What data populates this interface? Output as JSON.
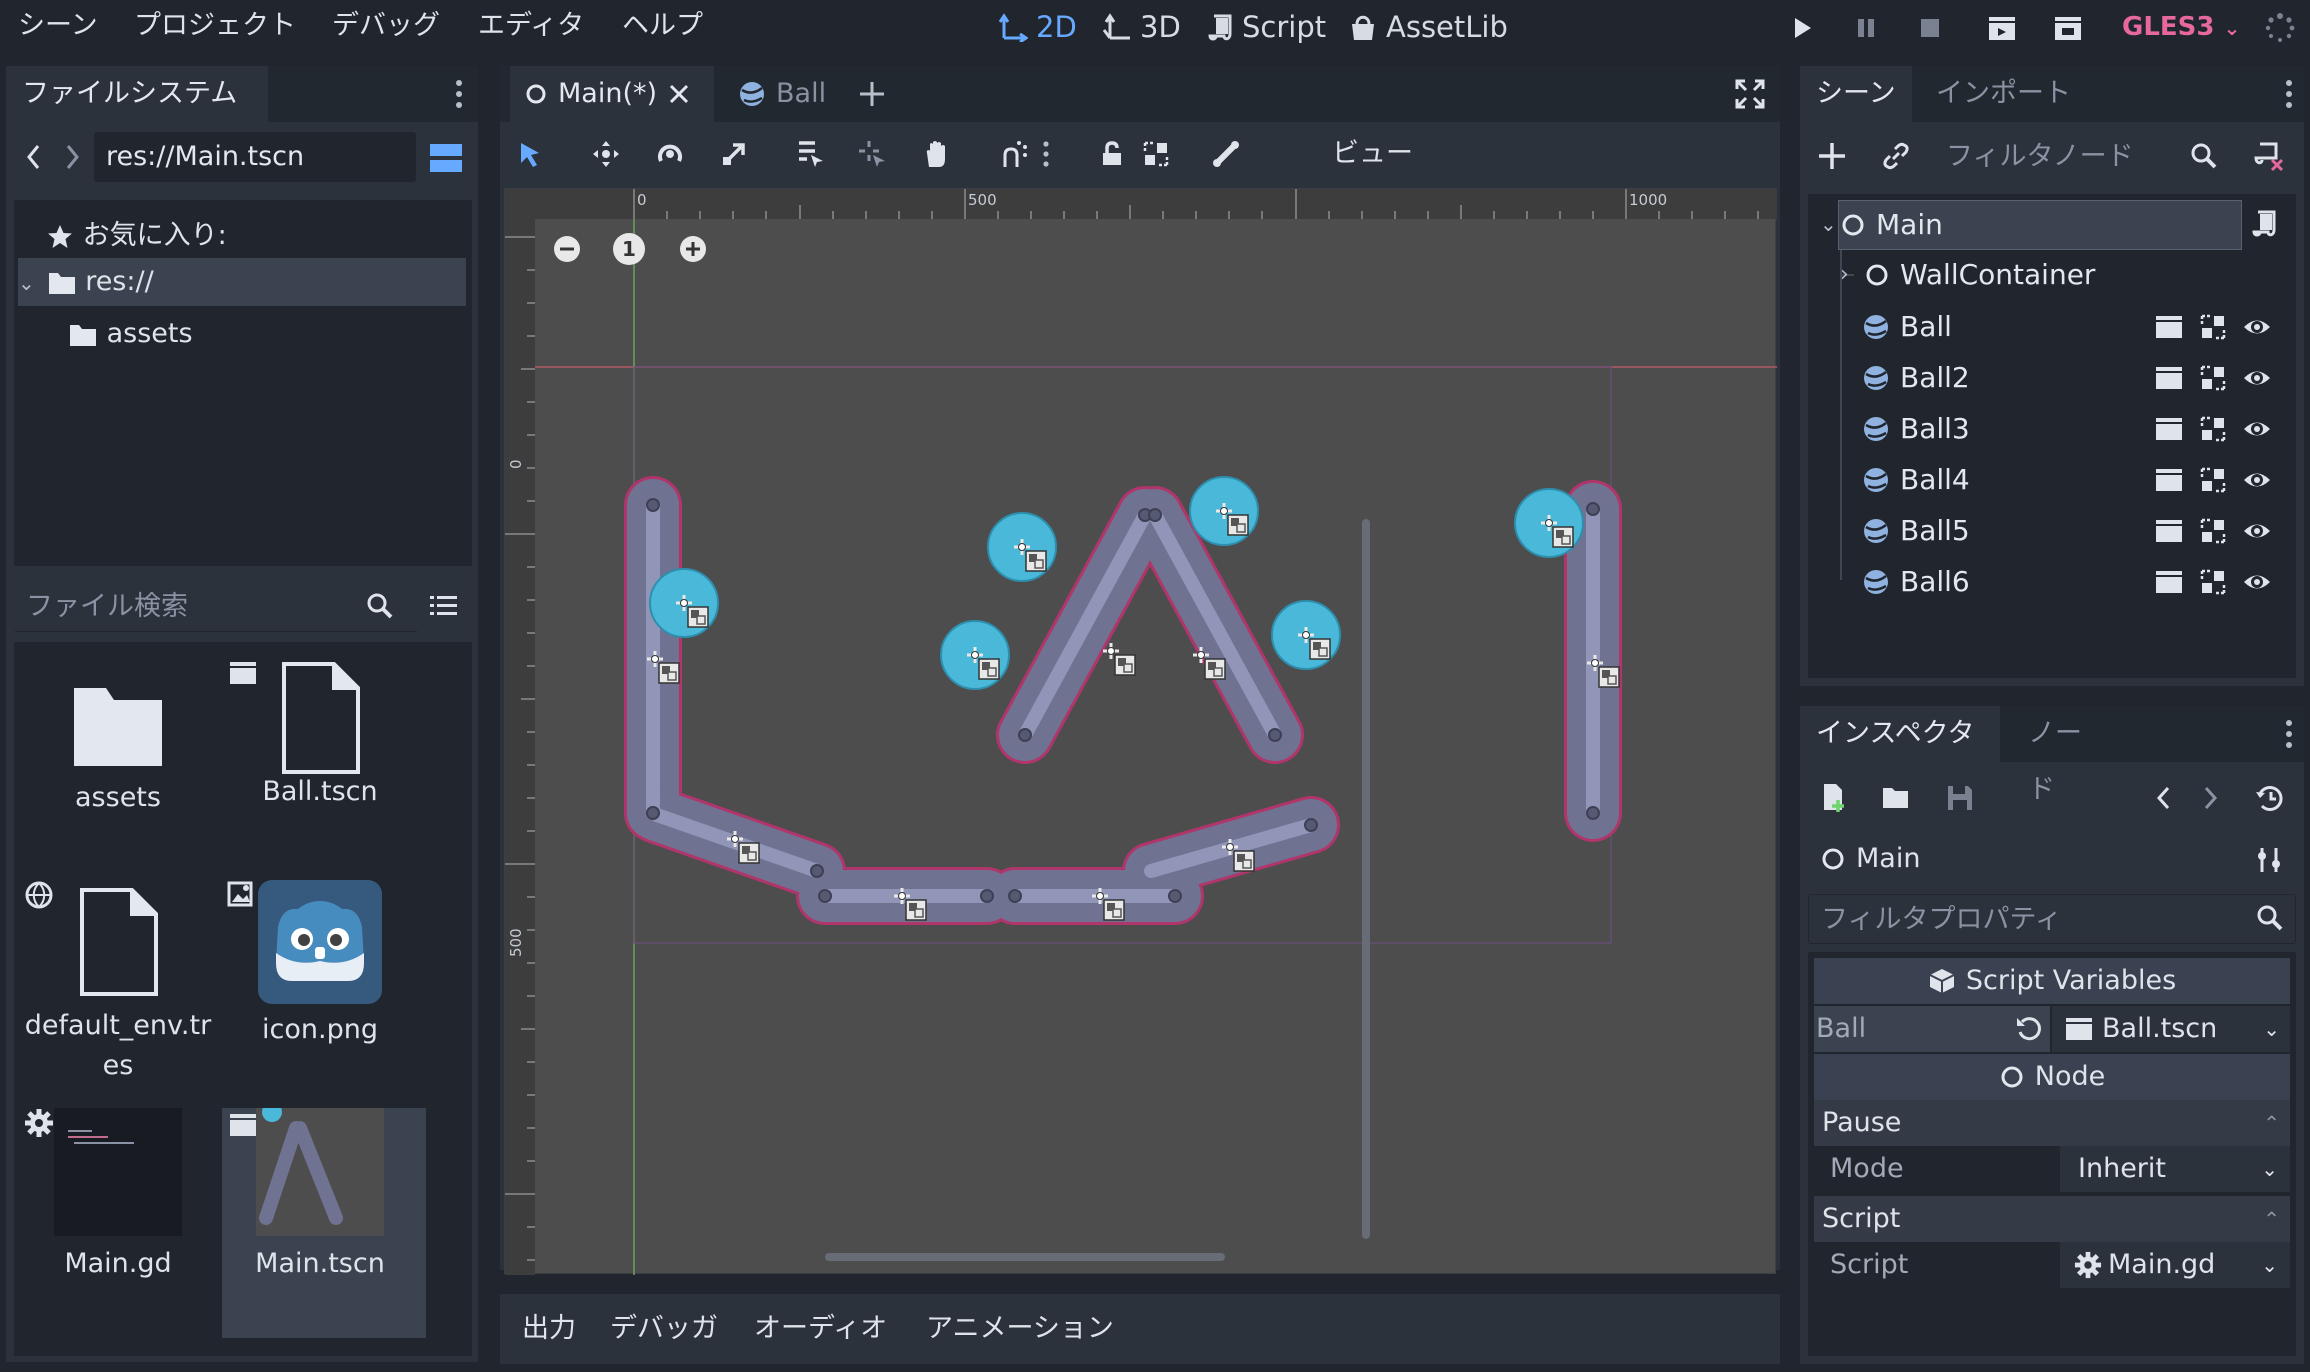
{
  "menu": [
    "シーン",
    "プロジェクト",
    "デバッグ",
    "エディタ",
    "ヘルプ"
  ],
  "workspaces": [
    {
      "label": "2D",
      "icon": "2d-icon",
      "active": true
    },
    {
      "label": "3D",
      "icon": "3d-icon",
      "active": false
    },
    {
      "label": "Script",
      "icon": "script-icon",
      "active": false
    },
    {
      "label": "AssetLib",
      "icon": "assetlib-icon",
      "active": false
    }
  ],
  "renderer": "GLES3",
  "filesystem": {
    "tab": "ファイルシステム",
    "path": "res://Main.tscn",
    "favorites": "お気に入り:",
    "tree": [
      "res://",
      "assets"
    ],
    "search_placeholder": "ファイル検索",
    "files": [
      "assets",
      "Ball.tscn",
      "default_env.tr\nes",
      "icon.png",
      "Main.gd",
      "Main.tscn"
    ]
  },
  "editor": {
    "tabs": [
      {
        "label": "Main(*)",
        "icon": "node-circle-icon",
        "active": true
      },
      {
        "label": "Ball",
        "icon": "rigidbody-icon",
        "active": false
      }
    ],
    "view_menu": "ビュー",
    "ruler_x": [
      "0",
      "500",
      "1000"
    ],
    "ruler_y": [
      "0",
      "500"
    ],
    "zoom_reset": "1"
  },
  "bottom_tabs": [
    "出力",
    "デバッガ",
    "オーディオ",
    "アニメーション"
  ],
  "scene": {
    "tabs": [
      "シーン",
      "インポート"
    ],
    "filter_placeholder": "フィルタノード",
    "nodes": [
      {
        "name": "Main",
        "icon": "node-circle-icon",
        "selected": true
      },
      {
        "name": "WallContainer",
        "icon": "node-circle-icon"
      },
      {
        "name": "Ball",
        "icon": "rigidbody-icon"
      },
      {
        "name": "Ball2",
        "icon": "rigidbody-icon"
      },
      {
        "name": "Ball3",
        "icon": "rigidbody-icon"
      },
      {
        "name": "Ball4",
        "icon": "rigidbody-icon"
      },
      {
        "name": "Ball5",
        "icon": "rigidbody-icon"
      },
      {
        "name": "Ball6",
        "icon": "rigidbody-icon"
      }
    ]
  },
  "inspector": {
    "tabs": [
      "インスペクタ",
      "ノード"
    ],
    "object": "Main",
    "filter_placeholder": "フィルタプロパティ",
    "section_script_vars": "Script Variables",
    "ball_label": "Ball",
    "ball_value": "Ball.tscn",
    "node_section": "Node",
    "pause_section": "Pause",
    "mode_label": "Mode",
    "mode_value": "Inherit",
    "script_section": "Script",
    "script_label": "Script",
    "script_value": "Main.gd"
  },
  "colors": {
    "accent": "#66a9ff",
    "gles": "#e7689d",
    "panel": "#2c323c",
    "background": "#20252e",
    "viewport": "#4d4d4d",
    "ball": "#4ab8d8",
    "wall": "#6f7290"
  }
}
